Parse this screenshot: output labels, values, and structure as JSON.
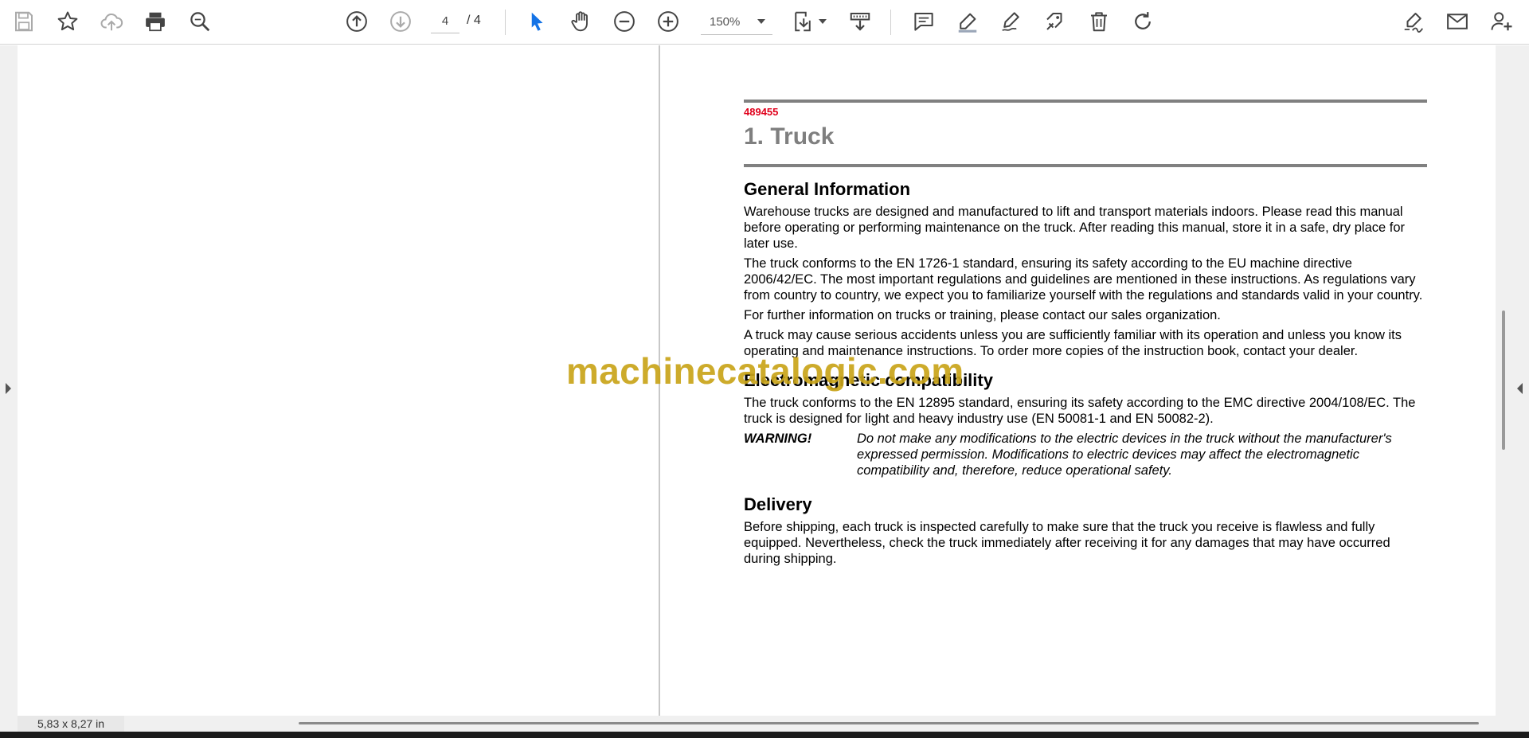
{
  "toolbar": {
    "icons": [
      "save-icon",
      "bookmark-star-icon",
      "cloud-upload-icon",
      "print-icon",
      "zoom-search-icon",
      "page-up-icon",
      "page-down-icon",
      "select-cursor-icon",
      "hand-tool-icon",
      "zoom-out-icon",
      "zoom-in-icon",
      "page-fit-icon",
      "scroll-mode-icon",
      "comment-icon",
      "highlight-pen-icon",
      "draw-pen-icon",
      "stamp-icon",
      "delete-icon",
      "rotate-icon",
      "fill-sign-icon",
      "email-icon",
      "add-user-icon"
    ],
    "page_current": "4",
    "page_total": "/  4",
    "zoom": "150%"
  },
  "document": {
    "doc_number": "489455",
    "title": "1. Truck",
    "sections": [
      {
        "heading": "General Information",
        "paragraphs": [
          "Warehouse trucks are designed and manufactured to lift and transport materials indoors. Please read this manual before operating or performing maintenance on the truck. After reading this manual, store it in a safe, dry place for later use.",
          "The truck conforms to the EN 1726-1 standard, ensuring its safety according to the EU machine directive 2006/42/EC. The most important regulations and guidelines are mentioned in these instructions. As regulations vary from country to country, we expect you to familiarize yourself with the regulations and standards valid in your country.",
          "For further information on trucks or training, please contact our sales organization.",
          "A truck may cause serious accidents unless you are sufficiently familiar with its operation and unless you know its operating and maintenance instructions. To order more copies of the instruction book, contact your dealer."
        ]
      },
      {
        "heading": "Electromagnetic compatibility",
        "paragraphs": [
          "The truck conforms to the EN 12895 standard, ensuring its safety according to the EMC directive 2004/108/EC. The truck is designed for light and heavy industry use (EN 50081-1 and EN 50082-2)."
        ],
        "warning_label": "WARNING!",
        "warning_text": "Do not make any modifications to the electric devices in the truck without the manufacturer's expressed permission. Modifications to electric devices may affect the electromagnetic compatibility and, therefore, reduce operational safety."
      },
      {
        "heading": "Delivery",
        "paragraphs": [
          "Before shipping, each truck is inspected carefully to make sure that the truck you receive is flawless and fully equipped. Nevertheless, check the truck immediately after receiving it for any damages that may have occurred during shipping."
        ]
      }
    ]
  },
  "watermark": "machinecatalogic.com",
  "status": {
    "page_size": "5,83 x 8,27 in"
  },
  "colors": {
    "accent_blue": "#1473e6",
    "doc_number_red": "#e0001b",
    "title_gray": "#7f7f7f",
    "watermark_gold": "#c9a41a"
  }
}
